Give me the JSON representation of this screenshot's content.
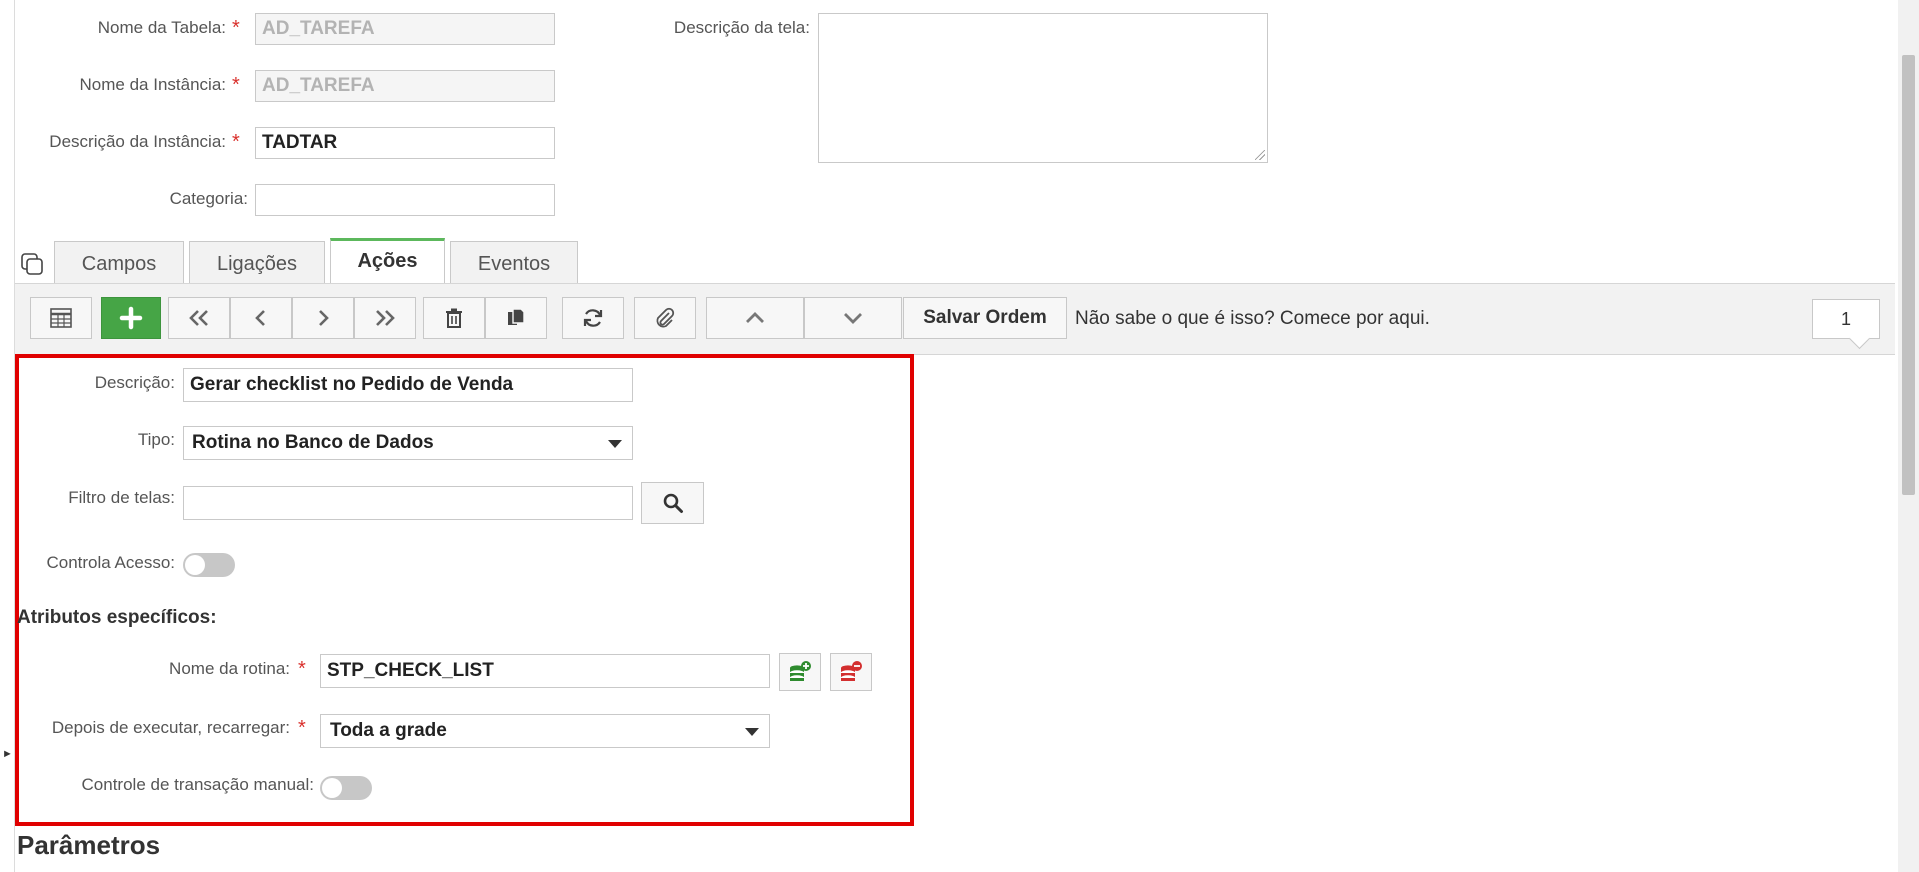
{
  "form": {
    "tabela_label": "Nome da Tabela:",
    "tabela_value": "AD_TAREFA",
    "instancia_label": "Nome da Instância:",
    "instancia_value": "AD_TAREFA",
    "desc_instancia_label": "Descrição da Instância:",
    "desc_instancia_value": "TADTAR",
    "categoria_label": "Categoria:",
    "categoria_value": "",
    "desc_tela_label": "Descrição da tela:",
    "desc_tela_value": "",
    "required_mark": "*"
  },
  "tabs": [
    {
      "label": "Campos",
      "active": false
    },
    {
      "label": "Ligações",
      "active": false
    },
    {
      "label": "Ações",
      "active": true
    },
    {
      "label": "Eventos",
      "active": false
    }
  ],
  "toolbar": {
    "save_order_label": "Salvar Ordem",
    "help_text": "Não sabe o que é isso? Comece por aqui.",
    "page_number": "1"
  },
  "action_form": {
    "descricao_label": "Descrição:",
    "descricao_value": "Gerar checklist no Pedido de Venda",
    "tipo_label": "Tipo:",
    "tipo_value": "Rotina no Banco de Dados",
    "filtro_label": "Filtro de telas:",
    "filtro_value": "",
    "controla_acesso_label": "Controla Acesso:",
    "controla_acesso_on": false,
    "atributos_title": "Atributos específicos:",
    "rotina_label": "Nome da rotina:",
    "rotina_value": "STP_CHECK_LIST",
    "recarregar_label": "Depois de executar, recarregar:",
    "recarregar_value": "Toda a grade",
    "transacao_label": "Controle de transação manual:",
    "transacao_on": false
  },
  "parametros_title": "Parâmetros",
  "colors": {
    "accent_green": "#46a546",
    "active_tab_border": "#5cb85c",
    "highlight_frame": "#e00000",
    "required": "#d9302c"
  }
}
